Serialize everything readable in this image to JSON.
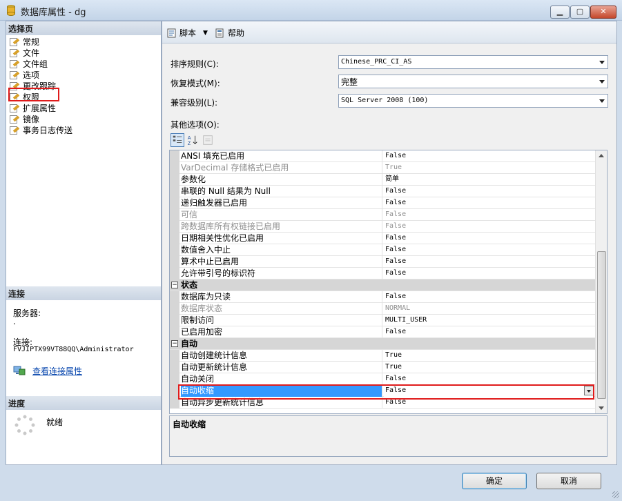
{
  "window": {
    "title": "数据库属性 - dg"
  },
  "left": {
    "select_page_title": "选择页",
    "nav_items": [
      "常规",
      "文件",
      "文件组",
      "选项",
      "更改跟踪",
      "权限",
      "扩展属性",
      "镜像",
      "事务日志传送"
    ],
    "connection_title": "连接",
    "server_label": "服务器:",
    "server_value": ".",
    "connection_label": "连接:",
    "connection_value": "FVJIPTX99VT88QQ\\Administrator",
    "view_connection_props": "查看连接属性",
    "progress_title": "进度",
    "progress_status": "就绪"
  },
  "toolbar": {
    "script_label": "脚本",
    "help_label": "帮助"
  },
  "fields": {
    "collation_label": "排序规则(C):",
    "collation_value": "Chinese_PRC_CI_AS",
    "recovery_label": "恢复模式(M):",
    "recovery_value": "完整",
    "compat_label": "兼容级别(L):",
    "compat_value": "SQL Server 2008 (100)",
    "other_options_label": "其他选项(O):"
  },
  "grid": {
    "rows": [
      {
        "name": "ANSI 填充已启用",
        "value": "False"
      },
      {
        "name": "VarDecimal 存储格式已启用",
        "value": "True",
        "disabled": true
      },
      {
        "name": "参数化",
        "value": "简单"
      },
      {
        "name": "串联的 Null 结果为 Null",
        "value": "False"
      },
      {
        "name": "递归触发器已启用",
        "value": "False"
      },
      {
        "name": "可信",
        "value": "False",
        "disabled": true
      },
      {
        "name": "跨数据库所有权链接已启用",
        "value": "False",
        "disabled": true
      },
      {
        "name": "日期相关性优化已启用",
        "value": "False"
      },
      {
        "name": "数值舍入中止",
        "value": "False"
      },
      {
        "name": "算术中止已启用",
        "value": "False"
      },
      {
        "name": "允许带引号的标识符",
        "value": "False"
      },
      {
        "name": "状态",
        "category": true
      },
      {
        "name": "数据库为只读",
        "value": "False"
      },
      {
        "name": "数据库状态",
        "value": "NORMAL",
        "disabled": true
      },
      {
        "name": "限制访问",
        "value": "MULTI_USER"
      },
      {
        "name": "已启用加密",
        "value": "False"
      },
      {
        "name": "自动",
        "category": true
      },
      {
        "name": "自动创建统计信息",
        "value": "True"
      },
      {
        "name": "自动更新统计信息",
        "value": "True"
      },
      {
        "name": "自动关闭",
        "value": "False"
      },
      {
        "name": "自动收缩",
        "value": "False",
        "selected": true
      },
      {
        "name": "自动异步更新统计信息",
        "value": "False"
      }
    ]
  },
  "description": {
    "title": "自动收缩"
  },
  "buttons": {
    "ok_label": "确定",
    "cancel_label": "取消"
  }
}
